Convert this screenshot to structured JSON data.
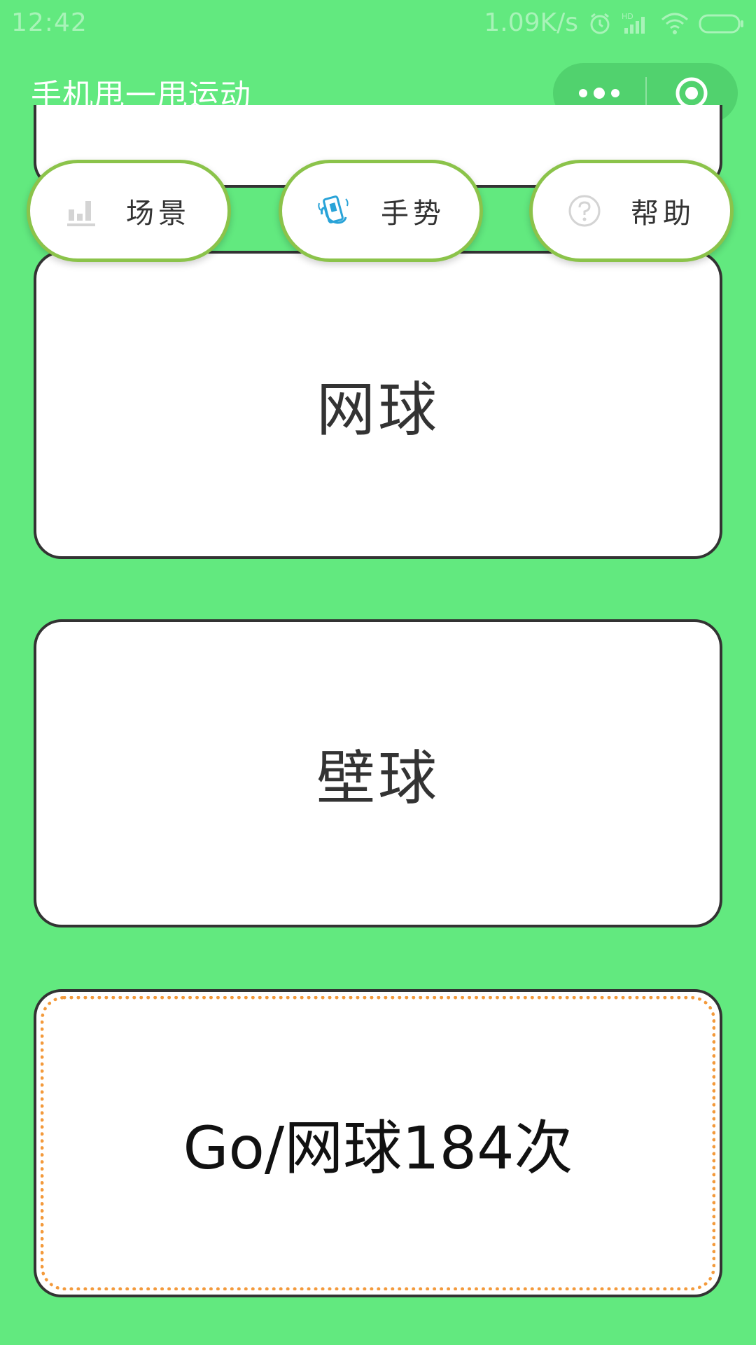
{
  "status_bar": {
    "time": "12:42",
    "net_speed": "1.09K/s",
    "icons": [
      "alarm-icon",
      "hd-signal-icon",
      "wifi-icon",
      "battery-icon"
    ]
  },
  "header": {
    "title": "手机甩一甩运动",
    "capsule": {
      "more_icon": "more-dots-icon",
      "close_icon": "target-circle-icon"
    }
  },
  "tabs": [
    {
      "label": "场景",
      "icon": "bar-chart-icon"
    },
    {
      "label": "手势",
      "icon": "hand-phone-icon"
    },
    {
      "label": "帮助",
      "icon": "question-circle-icon"
    }
  ],
  "cards": {
    "tennis": "网球",
    "squash": "壁球",
    "result": "Go/网球184次"
  },
  "colors": {
    "background": "#62e97f",
    "tab_border": "#8bc34a",
    "card_border": "#333333",
    "result_dotted": "#f39a3c",
    "gesture_icon": "#29a3d8"
  }
}
